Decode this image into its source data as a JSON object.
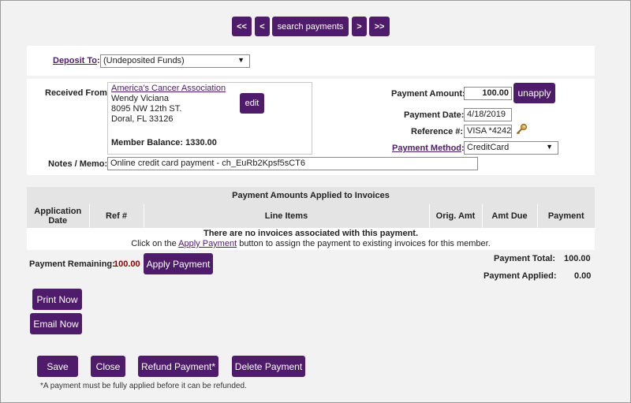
{
  "nav": {
    "first": "<<",
    "prev": "<",
    "search": "search payments",
    "next": ">",
    "last": ">>"
  },
  "deposit": {
    "label": "Deposit To",
    "colon": ":",
    "value": "(Undeposited Funds)"
  },
  "received": {
    "label": "Received From:",
    "org": "America's Cancer Association",
    "name": "Wendy Viciana",
    "address1": "8095 NW 12th ST.",
    "address2": "Doral, FL 33126",
    "balance": "Member Balance: 1330.00",
    "edit": "edit"
  },
  "payment": {
    "amount_label": "Payment Amount:",
    "amount": "100.00",
    "unapply": "unapply",
    "date_label": "Payment Date:",
    "date": "4/18/2019",
    "ref_label": "Reference #:",
    "ref": "VISA *4242",
    "method_label": "Payment Method",
    "method_colon": ":",
    "method": "CreditCard"
  },
  "notes": {
    "label": "Notes / Memo:",
    "value": "Online credit card payment - ch_EuRb2Kpsf5sCT6"
  },
  "invoices": {
    "title": "Payment Amounts Applied to Invoices",
    "columns": [
      "Application Date",
      "Ref #",
      "Line Items",
      "Orig. Amt",
      "Amt Due",
      "Payment"
    ],
    "empty_bold": "There are no invoices associated with this payment.",
    "empty_pre": "Click on the ",
    "empty_link": "Apply Payment",
    "empty_post": " button to assign the payment to existing invoices for this member."
  },
  "summary": {
    "remaining_label": "Payment Remaining:",
    "remaining": "100.00",
    "apply": "Apply Payment",
    "total_label": "Payment Total:",
    "total": "100.00",
    "applied_label": "Payment Applied:",
    "applied": "0.00"
  },
  "actions": {
    "print": "Print Now",
    "email": "Email Now",
    "save": "Save",
    "close": "Close",
    "refund": "Refund Payment*",
    "delete": "Delete Payment",
    "footnote": "*A payment must be fully applied before it can be refunded."
  },
  "colors": {
    "accent": "#4f1c6b",
    "remaining": "#8b0000",
    "background": "#f2f2f2"
  }
}
